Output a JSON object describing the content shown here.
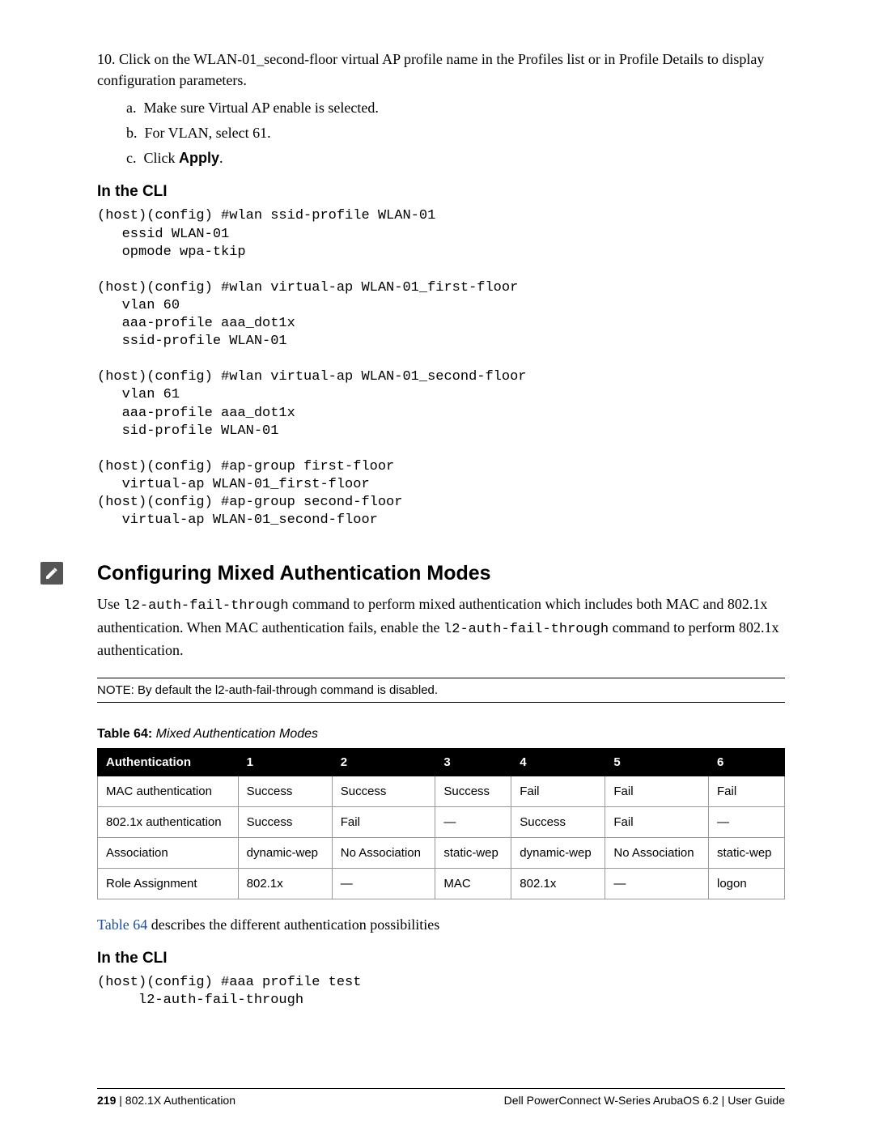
{
  "step10": {
    "num": "10.",
    "text_a": "Click on the WLAN-01_second-floor virtual AP profile name in the Profiles list or in Profile Details to display configuration parameters.",
    "sub": {
      "a": {
        "marker": "a.",
        "text": "Make sure Virtual AP enable is selected."
      },
      "b": {
        "marker": "b.",
        "text": "For VLAN, select 61."
      },
      "c": {
        "marker": "c.",
        "prefix": "Click ",
        "bold": "Apply",
        "suffix": "."
      }
    }
  },
  "cli_heading": "In the CLI",
  "cli_block1": "(host)(config) #wlan ssid-profile WLAN-01\n   essid WLAN-01\n   opmode wpa-tkip\n\n(host)(config) #wlan virtual-ap WLAN-01_first-floor\n   vlan 60\n   aaa-profile aaa_dot1x\n   ssid-profile WLAN-01\n\n(host)(config) #wlan virtual-ap WLAN-01_second-floor\n   vlan 61\n   aaa-profile aaa_dot1x\n   sid-profile WLAN-01\n\n(host)(config) #ap-group first-floor\n   virtual-ap WLAN-01_first-floor\n(host)(config) #ap-group second-floor\n   virtual-ap WLAN-01_second-floor",
  "section_heading": "Configuring Mixed Authentication Modes",
  "para1": {
    "pre": "Use ",
    "code1": "l2-auth-fail-through",
    "mid1": " command to perform mixed authentication which includes both MAC and 802.1x authentication. When MAC authentication fails, enable the ",
    "code2": "l2-auth-fail-through",
    "mid2": " command to perform 802.1x authentication."
  },
  "note_text": "NOTE: By default the l2-auth-fail-through command is disabled.",
  "table_caption": {
    "label": "Table 64:",
    "title": " Mixed Authentication Modes"
  },
  "table": {
    "headers": [
      "Authentication",
      "1",
      "2",
      "3",
      "4",
      "5",
      "6"
    ],
    "rows": [
      [
        "MAC authentication",
        "Success",
        "Success",
        "Success",
        "Fail",
        "Fail",
        "Fail"
      ],
      [
        "802.1x authentication",
        "Success",
        "Fail",
        "—",
        "Success",
        "Fail",
        "—"
      ],
      [
        "Association",
        "dynamic-wep",
        "No Association",
        "static-wep",
        "dynamic-wep",
        "No Association",
        "static-wep"
      ],
      [
        "Role Assignment",
        "802.1x",
        "—",
        "MAC",
        "802.1x",
        "—",
        "logon"
      ]
    ]
  },
  "after_table": {
    "link": "Table 64",
    "rest": " describes the different authentication possibilities"
  },
  "cli_heading2": "In the CLI",
  "cli_block2": "(host)(config) #aaa profile test\n     l2-auth-fail-through",
  "footer": {
    "page": "219",
    "sep": " | ",
    "left_text": "802.1X Authentication",
    "right_prefix": "Dell PowerConnect W-Series ArubaOS 6.2 ",
    "right_sep": " | ",
    "right_suffix": " User Guide"
  }
}
